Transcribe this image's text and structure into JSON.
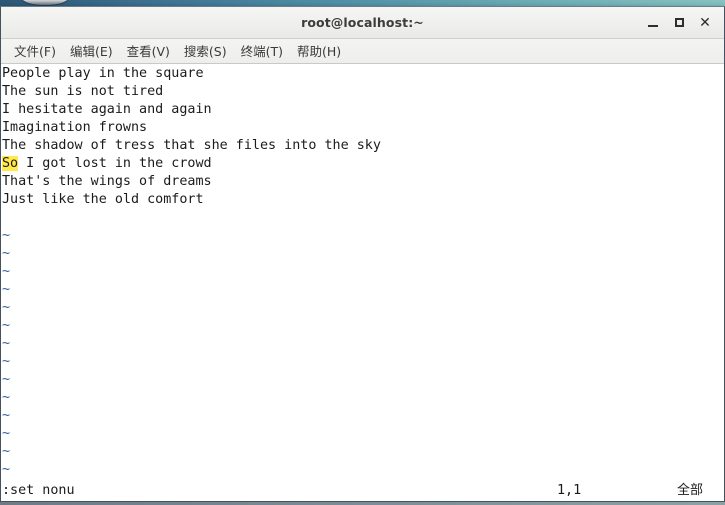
{
  "window": {
    "title": "root@localhost:~",
    "controls": [
      {
        "name": "minimize",
        "glyph": "_"
      },
      {
        "name": "maximize",
        "glyph": "□"
      },
      {
        "name": "close",
        "glyph": "✕"
      }
    ]
  },
  "menubar": {
    "items": [
      {
        "label": "文件(F)"
      },
      {
        "label": "编辑(E)"
      },
      {
        "label": "查看(V)"
      },
      {
        "label": "搜索(S)"
      },
      {
        "label": "终端(T)"
      },
      {
        "label": "帮助(H)"
      }
    ]
  },
  "editor": {
    "lines": [
      "People play in the square",
      "The sun is not tired",
      "I hesitate again and again",
      "Imagination frowns",
      "The shadow of tress that she files into the sky",
      "So I got lost in the crowd",
      "That's the wings of dreams",
      "Just like the old comfort"
    ],
    "highlight": {
      "line_index": 5,
      "text": "So",
      "rest": " I got lost in the crowd",
      "background_color": "#ffe94d"
    },
    "empty_marker": "~",
    "empty_marker_count": 15,
    "empty_marker_color": "#2f5d9e"
  },
  "statusline": {
    "command": ":set nonu",
    "position": "1,1",
    "scroll": "全部"
  },
  "colors": {
    "terminal_background": "#ffffff",
    "terminal_foreground": "#1b1b1b",
    "titlebar_background": "#f0f0ee",
    "desktop_gradient_left": "#2b5876",
    "desktop_gradient_right": "#86c3c2"
  }
}
